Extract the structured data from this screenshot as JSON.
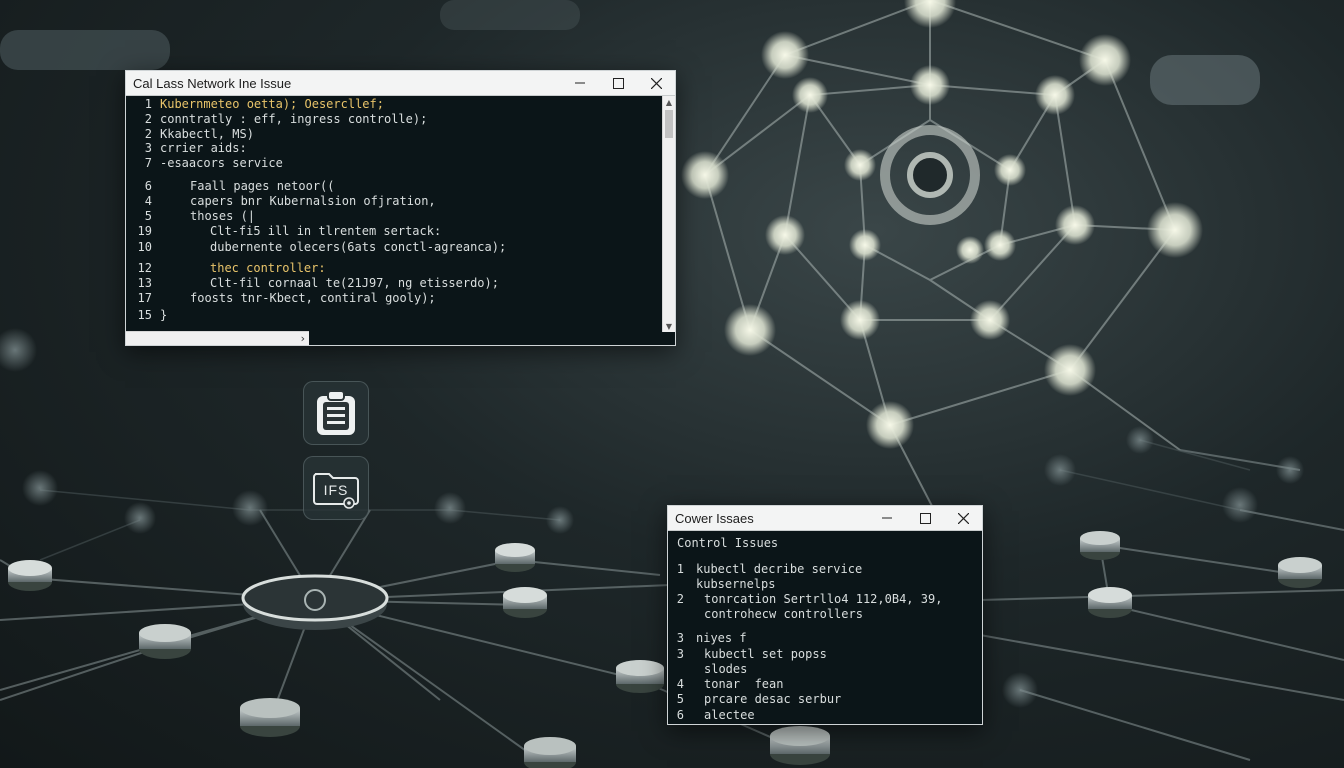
{
  "colors": {
    "terminal_bg": "#0b1518",
    "titlebar_bg": "#f3f4f4",
    "text": "#d9dede",
    "highlight": "#e8c46a"
  },
  "window_main": {
    "title": "Cal Lass Network Ine Issue",
    "controls": [
      "minimize-icon",
      "maximize-icon",
      "close-icon"
    ],
    "lines": [
      {
        "num": "1",
        "text": "Kubernmeteo oetta); Oesercllef;"
      },
      {
        "num": "2",
        "text": "conntratly : eff, ingress controlle);"
      },
      {
        "num": "2",
        "text": "Kkabectl, MS)"
      },
      {
        "num": "3",
        "text": "crrier aids:"
      },
      {
        "num": "7",
        "text": "-esaacors service"
      },
      {
        "num": "6",
        "text": "Faall pages netoor(("
      },
      {
        "num": "4",
        "text": "capers bnr Kubernalsion ofjration,"
      },
      {
        "num": "5",
        "text": "thoses (|"
      },
      {
        "num": "19",
        "text": "Clt-fi5 ill in tlrentem sertack:"
      },
      {
        "num": "10",
        "text": "dubernente olecers(6ats conctl-agreanca);"
      },
      {
        "num": "12",
        "text": "thec controller:"
      },
      {
        "num": "13",
        "text": "Clt-fil cornaal te(21J97, ng etisserdo);"
      },
      {
        "num": "17",
        "text": "foosts tnr-Kbect, contiral gooly);"
      },
      {
        "num": "15",
        "text": "}"
      }
    ]
  },
  "window_secondary": {
    "title": "Cower Issaes",
    "controls": [
      "minimize-icon",
      "maximize-icon",
      "close-icon"
    ],
    "heading": "Control Issues",
    "lines": [
      {
        "num": "1",
        "text": "kubectl decribe service"
      },
      {
        "num": "",
        "text": "kubsernelps"
      },
      {
        "num": "2",
        "text": "tonrcation Sertrllo4 112,0B4, 39,"
      },
      {
        "num": "",
        "text": "controhecw controllers"
      },
      {
        "num": "3",
        "text": "niyes f"
      },
      {
        "num": "3",
        "text": "kubectl set popss"
      },
      {
        "num": "",
        "text": "slodes"
      },
      {
        "num": "4",
        "text": "tonar  fean"
      },
      {
        "num": "5",
        "text": "prcare desac serbur"
      },
      {
        "num": "6",
        "text": "alectee"
      }
    ]
  },
  "dock": {
    "icons": [
      "clipboard-icon",
      "ifs-icon"
    ],
    "ifs_label": "IFS"
  }
}
